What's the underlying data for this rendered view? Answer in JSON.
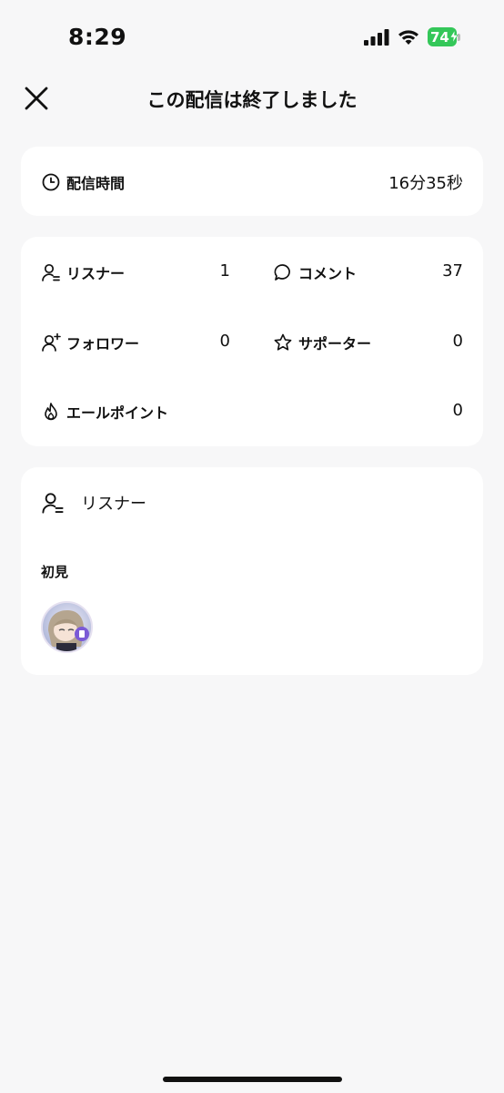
{
  "status_bar": {
    "time": "8:29",
    "battery": "74"
  },
  "header": {
    "title": "この配信は終了しました"
  },
  "duration": {
    "label": "配信時間",
    "value": "16分35秒"
  },
  "stats": {
    "listeners": {
      "label": "リスナー",
      "value": "1"
    },
    "comments": {
      "label": "コメント",
      "value": "37"
    },
    "followers": {
      "label": "フォロワー",
      "value": "0"
    },
    "supporters": {
      "label": "サポーター",
      "value": "0"
    },
    "yell_points": {
      "label": "エールポイント",
      "value": "0"
    }
  },
  "listeners_section": {
    "title": "リスナー",
    "first_time_label": "初見"
  },
  "colors": {
    "battery_green": "#34c759",
    "background": "#f7f7f8",
    "card": "#ffffff"
  }
}
